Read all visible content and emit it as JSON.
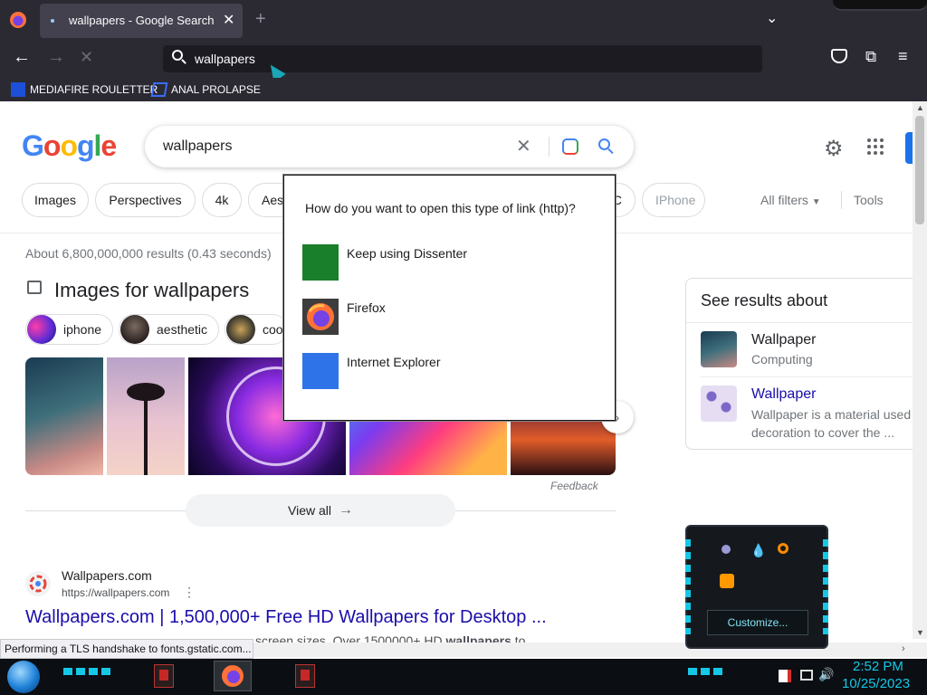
{
  "browser": {
    "tab_title": "wallpapers - Google Search",
    "address": "wallpapers",
    "bookmarks": [
      {
        "label": "MEDIAFIRE ROULETTER"
      },
      {
        "label": "ANAL PROLAPSE"
      }
    ]
  },
  "search": {
    "query": "wallpapers",
    "filters": [
      "Images",
      "Perspectives",
      "4k",
      "Aes",
      "C",
      "IPhone"
    ],
    "all_filters": "All filters",
    "tools": "Tools",
    "result_stats": "About 6,800,000,000 results (0.43 seconds)"
  },
  "images_section": {
    "title": "Images for wallpapers",
    "pills": [
      "iphone",
      "aesthetic",
      "coo"
    ],
    "feedback": "Feedback",
    "view_all": "View all"
  },
  "dialog": {
    "prompt": "How do you want to open this type of link (http)?",
    "options": [
      {
        "label": "Keep using Dissenter",
        "color": "#1a7f2a"
      },
      {
        "label": "Firefox",
        "icon": "firefox-icon"
      },
      {
        "label": "Internet Explorer",
        "color": "#2e74e8"
      }
    ]
  },
  "knowledge": {
    "title": "See results about",
    "items": [
      {
        "name": "Wallpaper",
        "sub": "Computing"
      },
      {
        "name": "Wallpaper",
        "sub": "Wallpaper is a material used",
        "sub2": "decoration to cover the ..."
      }
    ]
  },
  "result": {
    "site": "Wallpapers.com",
    "url": "https://wallpapers.com",
    "title": "Wallpapers.com | 1,500,000+ Free HD Wallpapers for Desktop ...",
    "snippet_pre": "screen sizes. Over 1500000+ HD ",
    "snippet_bold": "wallpapers",
    "snippet_post": " to ..."
  },
  "status_text": "Performing a TLS handshake to fonts.gstatic.com...",
  "widget": {
    "customize": "Customize..."
  },
  "taskbar": {
    "time": "2:52 PM",
    "date": "10/25/2023"
  },
  "colors": {
    "google_blue": "#4285f4",
    "link": "#1a0dab",
    "chrome_bg": "#2b2a33",
    "accent_cyan": "#14c8e6"
  }
}
